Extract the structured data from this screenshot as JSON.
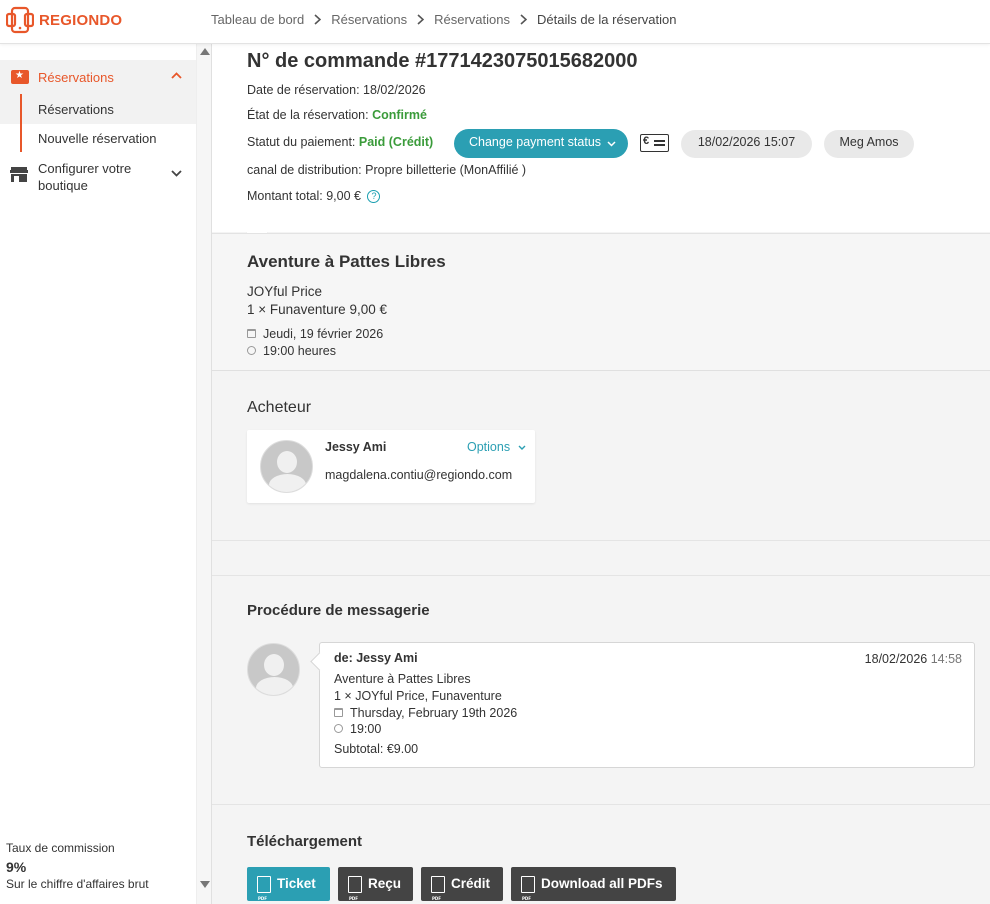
{
  "brand": {
    "name": "REGIONDO",
    "accent": "#e8572a",
    "teal": "#2b9fb3"
  },
  "breadcrumb": [
    "Tableau de bord",
    "Réservations",
    "Réservations",
    "Détails de la réservation"
  ],
  "sidebar": {
    "active_item": {
      "label": "Réservations",
      "icon": "star-ticket-icon"
    },
    "sub_items": [
      "Réservations",
      "Nouvelle réservation"
    ],
    "shop_item": {
      "label": "Configurer votre boutique",
      "icon": "store-icon"
    },
    "commission": {
      "label": "Taux de commission",
      "value": "9%",
      "sub": "Sur le chiffre d'affaires brut"
    }
  },
  "order": {
    "title": "N° de commande #1771423075015682000",
    "booking_date_label": "Date de réservation:",
    "booking_date": "18/02/2026",
    "status_label": "État de la réservation:",
    "status": "Confirmé",
    "payment_label": "Statut du paiement:",
    "payment": "Paid (Crédit)",
    "channel_label": "canal de distribution:",
    "channel": "Propre billetterie (MonAffilié )",
    "total_label": "Montant total:",
    "total": "9,00 €",
    "help": "?",
    "change_payment_button": "Change payment status",
    "cash_icon": "€",
    "timestamp": "18/02/2026 15:07",
    "agent": "Meg Amos"
  },
  "product": {
    "title": "Aventure à Pattes Libres",
    "price_name": "JOYful Price",
    "line": "1 × Funaventure 9,00 €",
    "date": "Jeudi, 19 février 2026",
    "time": "19:00 heures"
  },
  "buyer": {
    "heading": "Acheteur",
    "name": "Jessy Ami",
    "email": "magdalena.contiu@regiondo.com",
    "options": "Options"
  },
  "messaging": {
    "heading": "Procédure de messagerie",
    "from": "de: Jessy Ami",
    "date": "18/02/2026",
    "time": "14:58",
    "lines": [
      "Aventure à Pattes Libres",
      "1 × JOYful Price, Funaventure",
      "Thursday, February 19th 2026",
      "19:00",
      "Subtotal: €9.00"
    ]
  },
  "downloads": {
    "heading": "Téléchargement",
    "buttons": [
      "Ticket",
      "Reçu",
      "Crédit",
      "Download all PDFs"
    ]
  }
}
